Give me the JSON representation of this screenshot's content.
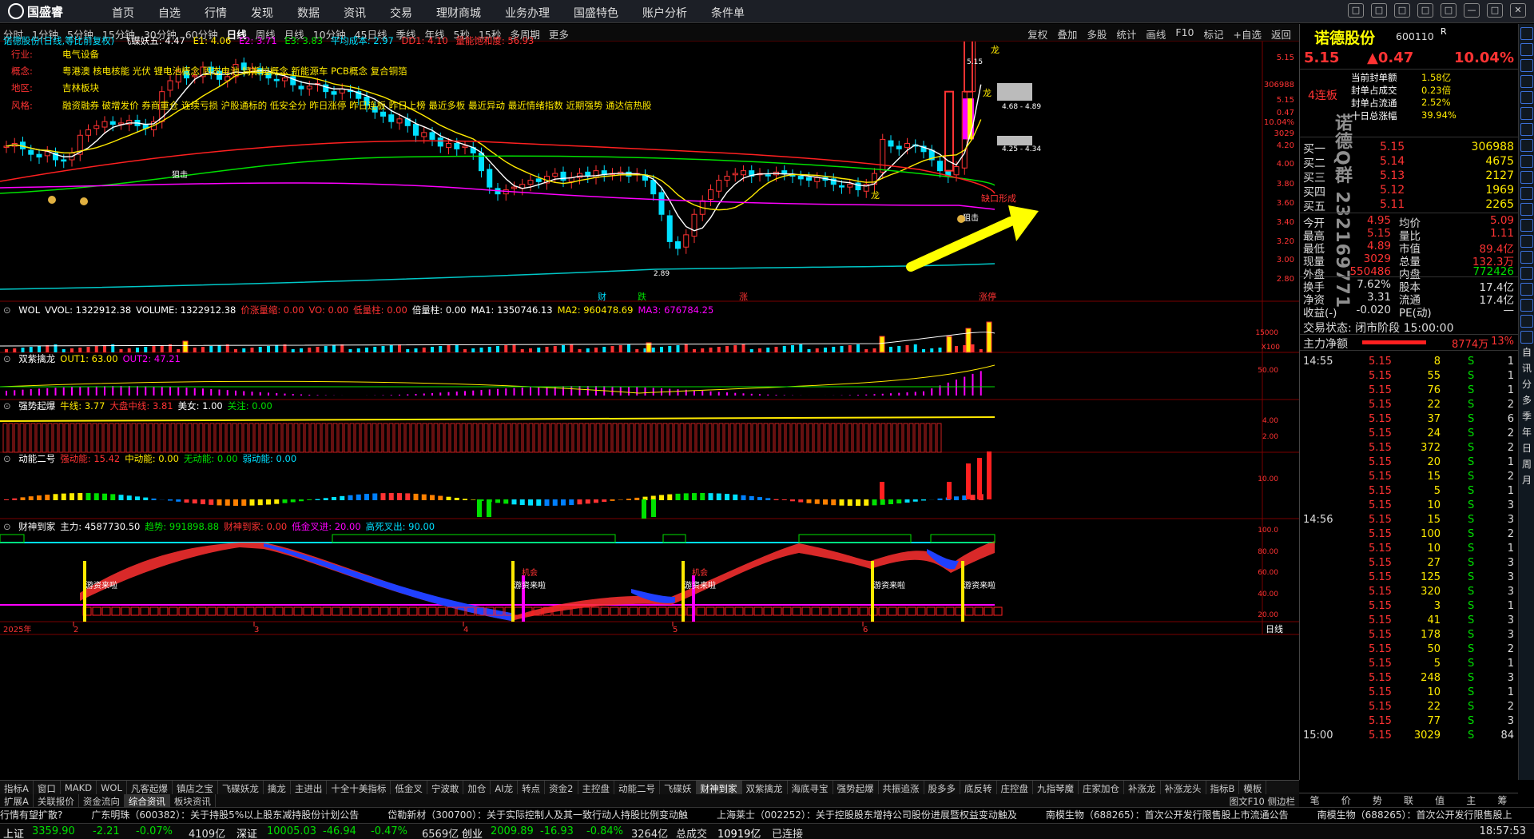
{
  "app": {
    "logo": "国盛睿",
    "menu": [
      "首页",
      "自选",
      "行情",
      "发现",
      "数据",
      "资讯",
      "交易",
      "理财商城",
      "业务办理",
      "国盛特色",
      "账户分析",
      "条件单"
    ],
    "window_buttons": [
      "□",
      "□",
      "□",
      "□",
      "□",
      "—",
      "□",
      "✕"
    ]
  },
  "period_bar": {
    "periods": [
      "分时",
      "1分钟",
      "5分钟",
      "15分钟",
      "30分钟",
      "60分钟",
      "日线",
      "周线",
      "月线",
      "10分钟",
      "45日线",
      "季线",
      "年线",
      "5秒",
      "15秒",
      "多周期",
      "更多"
    ],
    "active": "日线",
    "tools": [
      "复权",
      "叠加",
      "多股",
      "统计",
      "画线",
      "F10",
      "标记",
      "+自选",
      "返回"
    ]
  },
  "main_chart": {
    "header": {
      "name": "诺德股份(日线,等比前复权)",
      "ind": "飞碟妖五",
      "e1": "E1: 4.06",
      "e2": "E2: 3.71",
      "e3": "E3: 3.83",
      "avg": "平均成本: 2.97",
      "dd": "DD1: 4.10",
      "vol": "量能饱和度: 56.93",
      "mark": "龙",
      "kk": "飞蝶妖五: 4.47"
    },
    "info": [
      {
        "label": "行业:",
        "text": "电气设备"
      },
      {
        "label": "概念:",
        "text": "粤港澳 核电核能 光伏 锂电池概念 固态电池 特斯拉概念 新能源车 PCB概念 复合铜箔"
      },
      {
        "label": "地区:",
        "text": "吉林板块"
      },
      {
        "label": "风格:",
        "text": "融资融券 破增发价 券商重仓 连续亏损 沪股通标的 低安全分 昨日涨停 昨日连板 昨日上榜 最近多板 最近异动 最近情绪指数 近期强势 通达信热股"
      }
    ],
    "y_ticks": [
      "5.15",
      "306988",
      "5.15",
      "0.47",
      "10.04%",
      "3029",
      "4.20",
      "4.00",
      "3.80",
      "3.60",
      "3.40",
      "3.20",
      "3.00",
      "2.80"
    ],
    "annotations": {
      "high_label": "5.15",
      "low_label": "2.89",
      "range_label": "4.68 - 4.89",
      "range2": "4.25 - 4.34",
      "gap_text": "缺口形成",
      "dragon1": "龙",
      "dragon2": "龙",
      "dragon3": "龙",
      "hit1": "狙击",
      "hit2": "狙击",
      "bottom_marks": [
        "财",
        "跌",
        "涨",
        "涨停"
      ]
    }
  },
  "panels": [
    {
      "id": "wol",
      "title": "WOL",
      "items": [
        {
          "t": "VVOL: 1322912.38",
          "c": "#fff"
        },
        {
          "t": "VOLUME: 1322912.38",
          "c": "#fff"
        },
        {
          "t": "价涨量缩: 0.00",
          "c": "#ff3333"
        },
        {
          "t": "VO: 0.00",
          "c": "#ff3333"
        },
        {
          "t": "低量柱: 0.00",
          "c": "#ff3333"
        },
        {
          "t": "倍量柱: 0.00",
          "c": "#fff"
        },
        {
          "t": "MA1: 1350746.13",
          "c": "#fff"
        },
        {
          "t": "MA2: 960478.69",
          "c": "#ffea00"
        },
        {
          "t": "MA3: 676784.25",
          "c": "#ff00ff"
        }
      ],
      "ticks": [
        "15000",
        "X100"
      ]
    },
    {
      "id": "sz",
      "title": "双紫擒龙",
      "items": [
        {
          "t": "OUT1: 63.00",
          "c": "#ffea00"
        },
        {
          "t": "OUT2: 47.21",
          "c": "#ff00ff"
        }
      ],
      "ticks": [
        "50.00"
      ]
    },
    {
      "id": "qs",
      "title": "强势起爆",
      "items": [
        {
          "t": "牛线: 3.77",
          "c": "#ffea00"
        },
        {
          "t": "大盘中线: 3.81",
          "c": "#ff3333"
        },
        {
          "t": "美女: 1.00",
          "c": "#fff"
        },
        {
          "t": "关注: 0.00",
          "c": "#00e000"
        }
      ],
      "ticks": [
        "4.00",
        "2.00"
      ]
    },
    {
      "id": "dn",
      "title": "动能二号",
      "items": [
        {
          "t": "强动能: 15.42",
          "c": "#ff3333"
        },
        {
          "t": "中动能: 0.00",
          "c": "#ffea00"
        },
        {
          "t": "无动能: 0.00",
          "c": "#00e000"
        },
        {
          "t": "弱动能: 0.00",
          "c": "#00e0ff"
        }
      ],
      "ticks": [
        "10.00"
      ]
    },
    {
      "id": "cs",
      "title": "财神到家",
      "items": [
        {
          "t": "主力: 4587730.50",
          "c": "#fff"
        },
        {
          "t": "趋势: 991898.88",
          "c": "#00e000"
        },
        {
          "t": "财神到家: 0.00",
          "c": "#ff3333"
        },
        {
          "t": "低金叉进: 20.00",
          "c": "#ff00ff"
        },
        {
          "t": "高死叉出: 90.00",
          "c": "#00e0ff"
        }
      ],
      "ticks": [
        "100.0",
        "80.00",
        "60.00",
        "40.00",
        "20.00"
      ],
      "labels": [
        "游资来啦",
        "游资来啦",
        "游资来啦",
        "游资来啦",
        "游资来啦",
        "机会",
        "机会"
      ]
    }
  ],
  "x_axis": {
    "year": "2025年",
    "months": [
      "2",
      "3",
      "4",
      "5",
      "6"
    ],
    "period": "日线"
  },
  "tabs1": [
    "指标A",
    "窗口",
    "MAKD",
    "WOL",
    "凡客起爆",
    "镇店之宝",
    "飞碟妖龙",
    "擒龙",
    "主进出",
    "十全十美指标",
    "低金叉",
    "宁波敢",
    "加仓",
    "AI龙",
    "转点",
    "资金2",
    "主控盘",
    "动能二号",
    "飞碟妖",
    "财神到家",
    "双紫擒龙",
    "海底寻宝",
    "强势起爆",
    "共振追涨",
    "股多多",
    "底反转",
    "庄控盘",
    "九指琴魔",
    "庄家加仓",
    "补涨龙",
    "补涨龙头",
    "指标B",
    "模板"
  ],
  "tabs2": {
    "items": [
      "扩展A",
      "关联报价",
      "资金流向",
      "综合资讯",
      "板块资讯"
    ],
    "active": "综合资讯",
    "right": "图文F10 侧边栏"
  },
  "right_panel": {
    "name": "诺德股份",
    "code": "600110",
    "r": "R",
    "price": "5.15",
    "change": "▲0.47",
    "pct": "10.04%",
    "limit_info": {
      "streak": "4连板",
      "items": [
        {
          "k": "当前封单额",
          "v": "1.58亿"
        },
        {
          "k": "封单占成交",
          "v": "0.23倍"
        },
        {
          "k": "封单占流通",
          "v": "2.52%"
        },
        {
          "k": "十日总涨幅",
          "v": "39.94%"
        }
      ]
    },
    "watermark": "诺德Q群 232169771",
    "orderbook": [
      {
        "l": "买一",
        "p": "5.15",
        "v": "306988"
      },
      {
        "l": "买二",
        "p": "5.14",
        "v": "4675"
      },
      {
        "l": "买三",
        "p": "5.13",
        "v": "2127"
      },
      {
        "l": "买四",
        "p": "5.12",
        "v": "1969"
      },
      {
        "l": "买五",
        "p": "5.11",
        "v": "2265"
      }
    ],
    "stats": [
      {
        "a": "今开",
        "av": "4.95",
        "b": "均价",
        "bv": "5.09"
      },
      {
        "a": "最高",
        "av": "5.15",
        "b": "量比",
        "bv": "1.11"
      },
      {
        "a": "最低",
        "av": "4.89",
        "b": "市值",
        "bv": "89.4亿"
      },
      {
        "a": "现量",
        "av": "3029",
        "b": "总量",
        "bv": "132.3万"
      },
      {
        "a": "外盘",
        "av": "550486",
        "b": "内盘",
        "bv": "772426"
      }
    ],
    "stats2": [
      {
        "a": "换手",
        "av": "7.62%",
        "b": "股本",
        "bv": "17.4亿"
      },
      {
        "a": "净资",
        "av": "3.31",
        "b": "流通",
        "bv": "17.4亿"
      },
      {
        "a": "收益(-)",
        "av": "-0.020",
        "b": "PE(动)",
        "bv": "—"
      }
    ],
    "trade_status": "交易状态: 闭市阶段 15:00:00",
    "net": {
      "label": "主力净额",
      "value": "8774万",
      "pct": "13%"
    },
    "ticks": [
      {
        "t": "14:55",
        "p": "5.15",
        "v": "8",
        "s": "S",
        "n": "1"
      },
      {
        "t": "",
        "p": "5.15",
        "v": "55",
        "s": "S",
        "n": "1"
      },
      {
        "t": "",
        "p": "5.15",
        "v": "76",
        "s": "S",
        "n": "1"
      },
      {
        "t": "",
        "p": "5.15",
        "v": "22",
        "s": "S",
        "n": "2"
      },
      {
        "t": "",
        "p": "5.15",
        "v": "37",
        "s": "S",
        "n": "6"
      },
      {
        "t": "",
        "p": "5.15",
        "v": "24",
        "s": "S",
        "n": "2"
      },
      {
        "t": "",
        "p": "5.15",
        "v": "372",
        "s": "S",
        "n": "2"
      },
      {
        "t": "",
        "p": "5.15",
        "v": "20",
        "s": "S",
        "n": "1"
      },
      {
        "t": "",
        "p": "5.15",
        "v": "15",
        "s": "S",
        "n": "2"
      },
      {
        "t": "",
        "p": "5.15",
        "v": "5",
        "s": "S",
        "n": "1"
      },
      {
        "t": "",
        "p": "5.15",
        "v": "10",
        "s": "S",
        "n": "3"
      },
      {
        "t": "14:56",
        "p": "5.15",
        "v": "15",
        "s": "S",
        "n": "3"
      },
      {
        "t": "",
        "p": "5.15",
        "v": "100",
        "s": "S",
        "n": "2"
      },
      {
        "t": "",
        "p": "5.15",
        "v": "10",
        "s": "S",
        "n": "1"
      },
      {
        "t": "",
        "p": "5.15",
        "v": "27",
        "s": "S",
        "n": "3"
      },
      {
        "t": "",
        "p": "5.15",
        "v": "125",
        "s": "S",
        "n": "3"
      },
      {
        "t": "",
        "p": "5.15",
        "v": "320",
        "s": "S",
        "n": "3"
      },
      {
        "t": "",
        "p": "5.15",
        "v": "3",
        "s": "S",
        "n": "1"
      },
      {
        "t": "",
        "p": "5.15",
        "v": "41",
        "s": "S",
        "n": "3"
      },
      {
        "t": "",
        "p": "5.15",
        "v": "178",
        "s": "S",
        "n": "3"
      },
      {
        "t": "",
        "p": "5.15",
        "v": "50",
        "s": "S",
        "n": "2"
      },
      {
        "t": "",
        "p": "5.15",
        "v": "5",
        "s": "S",
        "n": "1"
      },
      {
        "t": "",
        "p": "5.15",
        "v": "248",
        "s": "S",
        "n": "3"
      },
      {
        "t": "",
        "p": "5.15",
        "v": "10",
        "s": "S",
        "n": "1"
      },
      {
        "t": "",
        "p": "5.15",
        "v": "22",
        "s": "S",
        "n": "2"
      },
      {
        "t": "",
        "p": "5.15",
        "v": "77",
        "s": "S",
        "n": "3"
      },
      {
        "t": "15:00",
        "p": "5.15",
        "v": "3029",
        "s": "S",
        "n": "84"
      }
    ],
    "tabs": [
      "笔",
      "价",
      "势",
      "联",
      "值",
      "主",
      "筹"
    ]
  },
  "sidebar": [
    "自",
    "讯",
    "分",
    "多",
    "季",
    "年",
    "日",
    "周",
    "月"
  ],
  "news": [
    "行情有望扩散?",
    "广东明珠（600382）：关于持股5%以上股东减持股份计划公告",
    "岱勒新材（300700）：关于实际控制人及其一致行动人持股比例变动触",
    "上海莱士（002252）：关于控股股东增持公司股份进展暨权益变动触及",
    "南模生物（688265）：首次公开发行限售股上市流通公告",
    "南模生物（688265）：首次公开发行限售股上"
  ],
  "status": {
    "sh_label": "上证",
    "sh": "3359.90",
    "sh_chg": "-2.21",
    "sh_pct": "-0.07%",
    "sh_amt": "4109亿",
    "sz_label": "深证",
    "sz": "10005.03",
    "sz_chg": "-46.94",
    "sz_pct": "-0.47%",
    "sz_amt": "6569亿",
    "cy_label": "创业",
    "cy": "2009.89",
    "cy_chg": "-16.93",
    "cy_pct": "-0.84%",
    "cy_amt": "3264亿",
    "total_label": "总成交",
    "total": "10919亿",
    "conn": "已连接",
    "time": "18:57:53"
  },
  "colors": {
    "up": "#ff3333",
    "down": "#00e0ff",
    "ma5": "#ffffff",
    "ma10": "#ffea00",
    "ma20": "#00e000",
    "ma60": "#ff00ff",
    "ma120": "#ff2020",
    "arrow": "#ffff00"
  },
  "icons": [
    "logo-icon",
    "yellow-arrow-icon",
    "money-bag-icon"
  ]
}
